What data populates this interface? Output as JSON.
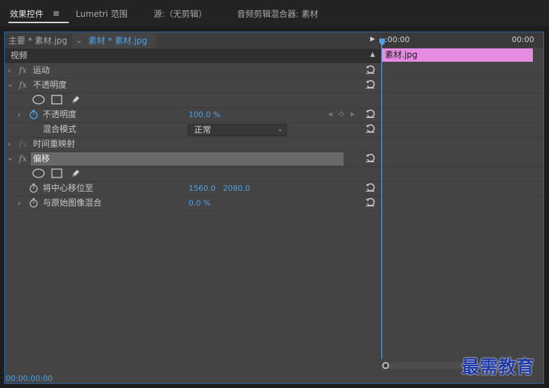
{
  "tabs": [
    {
      "label": "效果控件"
    },
    {
      "label": "Lumetri 范围"
    },
    {
      "label": "源:（无剪辑）"
    },
    {
      "label": "音频剪辑混合器: 素材"
    }
  ],
  "clip_header": {
    "master_label": "主要 * 素材.jpg",
    "sequence_label": "素材 * 素材.jpg"
  },
  "timeline": {
    "start_time": ":00:00",
    "end_time": "00:00",
    "clip_name": "素材.jpg"
  },
  "section_video": "视频",
  "effects": {
    "motion": {
      "name": "运动"
    },
    "opacity": {
      "name": "不透明度",
      "prop_opacity_label": "不透明度",
      "prop_opacity_value": "100.0 %",
      "blend_label": "混合模式",
      "blend_value": "正常"
    },
    "time_remap": {
      "name": "时间重映射"
    },
    "offset": {
      "name": "偏移",
      "shift_center_label": "将中心移位至",
      "shift_center_x": "1560.0",
      "shift_center_y": "2080.0",
      "blend_original_label": "与原始图像混合",
      "blend_original_value": "0.0 %"
    }
  },
  "fx_glyph": "fx",
  "footer_time": "00:00:00:00",
  "watermark": "最需教育",
  "colors": {
    "accent": "#4fa1e3",
    "clip": "#e58be1",
    "panel_border": "#2c68a9"
  }
}
